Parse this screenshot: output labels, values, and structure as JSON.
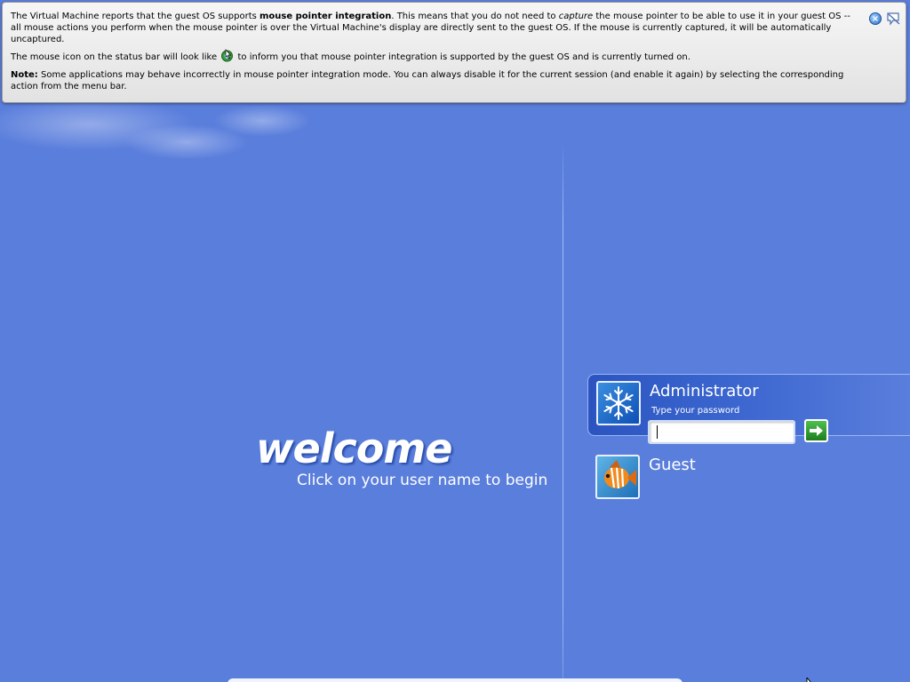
{
  "vm_banner": {
    "para1": {
      "t1": "The Virtual Machine reports that the guest OS supports ",
      "b1": "mouse pointer integration",
      "t2": ". This means that you do not need to ",
      "i1": "capture",
      "t3": " the mouse pointer to be able to use it in your guest OS -- all mouse actions you perform when the mouse pointer is over the Virtual Machine's display are directly sent to the guest OS. If the mouse is currently captured, it will be automatically uncaptured."
    },
    "para2": {
      "t1": "The mouse icon on the status bar will look like ",
      "t2": " to inform you that mouse pointer integration is supported by the guest OS and is currently turned on."
    },
    "para3": {
      "label": "Note:",
      "text": " Some applications may behave incorrectly in mouse pointer integration mode. You can always disable it for the current session (and enable it again) by selecting the corresponding action from the menu bar."
    },
    "close_glyph": "×",
    "icons": {
      "status": "mouse-integration-icon",
      "close": "close-icon",
      "dont_show": "dont-show-again-icon"
    }
  },
  "welcome": {
    "title": "welcome",
    "subtitle": "Click on your user name to begin"
  },
  "users": {
    "administrator": {
      "name": "Administrator",
      "password_label": "Type your password",
      "password_value": "",
      "picture_icon": "snowflake-icon"
    },
    "guest": {
      "name": "Guest",
      "picture_icon": "fish-icon"
    }
  },
  "go_icon": "arrow-right-icon",
  "colors": {
    "background": "#5a7edc",
    "tile_selected": "#2b54c0",
    "go_button": "#2f9a2f"
  }
}
